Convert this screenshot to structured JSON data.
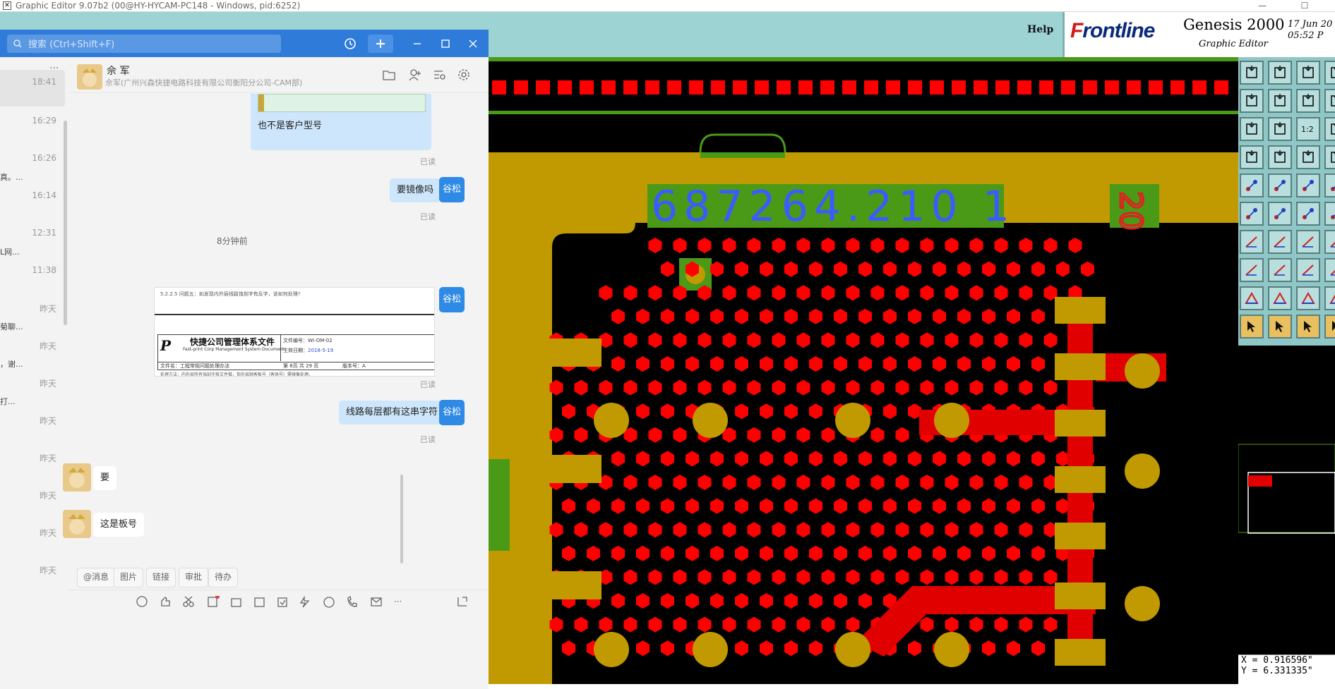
{
  "os_window": {
    "title": "Graphic Editor 9.07b2 (00@HY-HYCAM-PC148 - Windows, pid:6252)",
    "minimize": "—",
    "maximize": "☐",
    "close": "✕"
  },
  "genesis": {
    "help_label": "Help",
    "logo_text_f": "F",
    "logo_text_rest": "rontline",
    "product": "Genesis 2000",
    "subtitle": "Graphic Editor",
    "date_line1": "17 Jun 20",
    "date_line2": "05:52 P",
    "board_text": "687264.210 1",
    "layer_number": "20",
    "coord_x": "X = 0.916596\"",
    "coord_y": "Y = 6.331335\"",
    "zoom_label": "1:2",
    "colors": {
      "mask": "#ff0000",
      "copper": "#c09a00",
      "silk": "#4a9a18",
      "text": "#3a5cff",
      "background": "#000000"
    }
  },
  "chat": {
    "search_placeholder": "搜索 (Ctrl+Shift+F)",
    "contact_name": "佘 军",
    "contact_org": "佘军(广州兴森快捷电路科技有限公司衡阳分公司-CAM部)",
    "list_more": "···",
    "list_items": [
      {
        "time": "18:41",
        "snippet": ""
      },
      {
        "time": "16:29",
        "snippet": ""
      },
      {
        "time": "16:26",
        "snippet": "真。..."
      },
      {
        "time": "16:14",
        "snippet": ""
      },
      {
        "time": "12:31",
        "snippet": "L网..."
      },
      {
        "time": "11:38",
        "snippet": ""
      },
      {
        "time": "昨天",
        "snippet": "菊聊..."
      },
      {
        "time": "昨天",
        "snippet": "，谢..."
      },
      {
        "time": "昨天",
        "snippet": "打..."
      },
      {
        "time": "昨天",
        "snippet": ""
      },
      {
        "time": "昨天",
        "snippet": ""
      },
      {
        "time": "昨天",
        "snippet": ""
      },
      {
        "time": "昨天",
        "snippet": ""
      },
      {
        "time": "昨天",
        "snippet": ""
      }
    ],
    "messages": {
      "m1_text": "也不是客户型号",
      "m1_read": "已读",
      "m2_text": "要镜像吗",
      "m2_read": "已读",
      "my_badge": "谷松",
      "separator": "8分钟前",
      "m3_read": "已读",
      "m4_text": "线路每层都有这串字符",
      "m4_read": "已读",
      "m5_text": "要",
      "m6_text": "这是板号"
    },
    "doc_image": {
      "top_line": "5.2.2.5 问题五：如发现内外层线路蚀刻字有反字，该如何处理?",
      "company_title": "快捷公司管理体系文件",
      "company_sub": "Fast-print Corp Management System Document",
      "doc_no_label": "文件编号：",
      "doc_no": "WI-OM-02",
      "date_label": "生效日期：",
      "date": "2018-5-19",
      "file_label": "文件名：",
      "file_name": "工程常规问题处理办法",
      "page_info": "第 8页 共 29 页",
      "version": "版本号：A",
      "bottom_line": "处理方法：内外层所有蚀刻字按文件做，但外层顾客板号（客供号）需镜像处理。"
    },
    "quick_buttons": [
      "@消息",
      "图片",
      "链接",
      "审批",
      "待办"
    ]
  }
}
